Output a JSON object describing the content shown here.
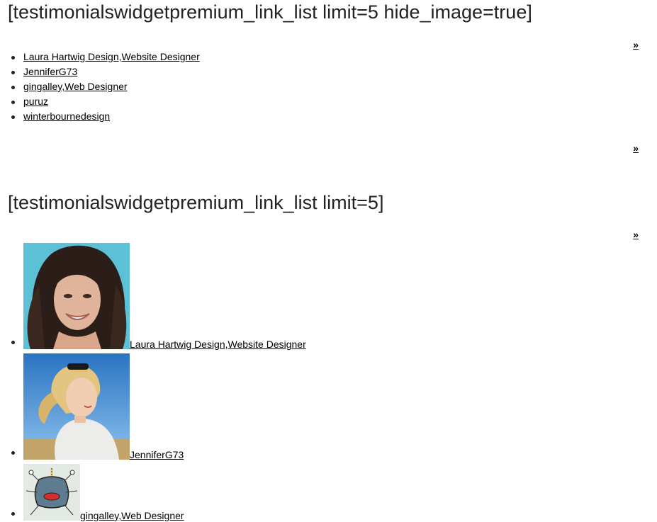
{
  "section1": {
    "heading": "[testimonialswidgetpremium_link_list limit=5 hide_image=true]",
    "more_top": "»",
    "more_bottom": "»",
    "items": [
      {
        "label": "Laura Hartwig Design,Website Designer"
      },
      {
        "label": "JenniferG73"
      },
      {
        "label": "gingalley,Web Designer"
      },
      {
        "label": "puruz"
      },
      {
        "label": "winterbournedesign"
      }
    ]
  },
  "section2": {
    "heading": "[testimonialswidgetpremium_link_list limit=5]",
    "more_top": "»",
    "items": [
      {
        "label": "Laura Hartwig Design,Website Designer",
        "image": "woman-curly-hair-portrait"
      },
      {
        "label": "JenniferG73",
        "image": "woman-blonde-sunglasses-portrait"
      },
      {
        "label": "gingalley,Web Designer",
        "image": "cartoon-monster-avatar"
      }
    ]
  }
}
